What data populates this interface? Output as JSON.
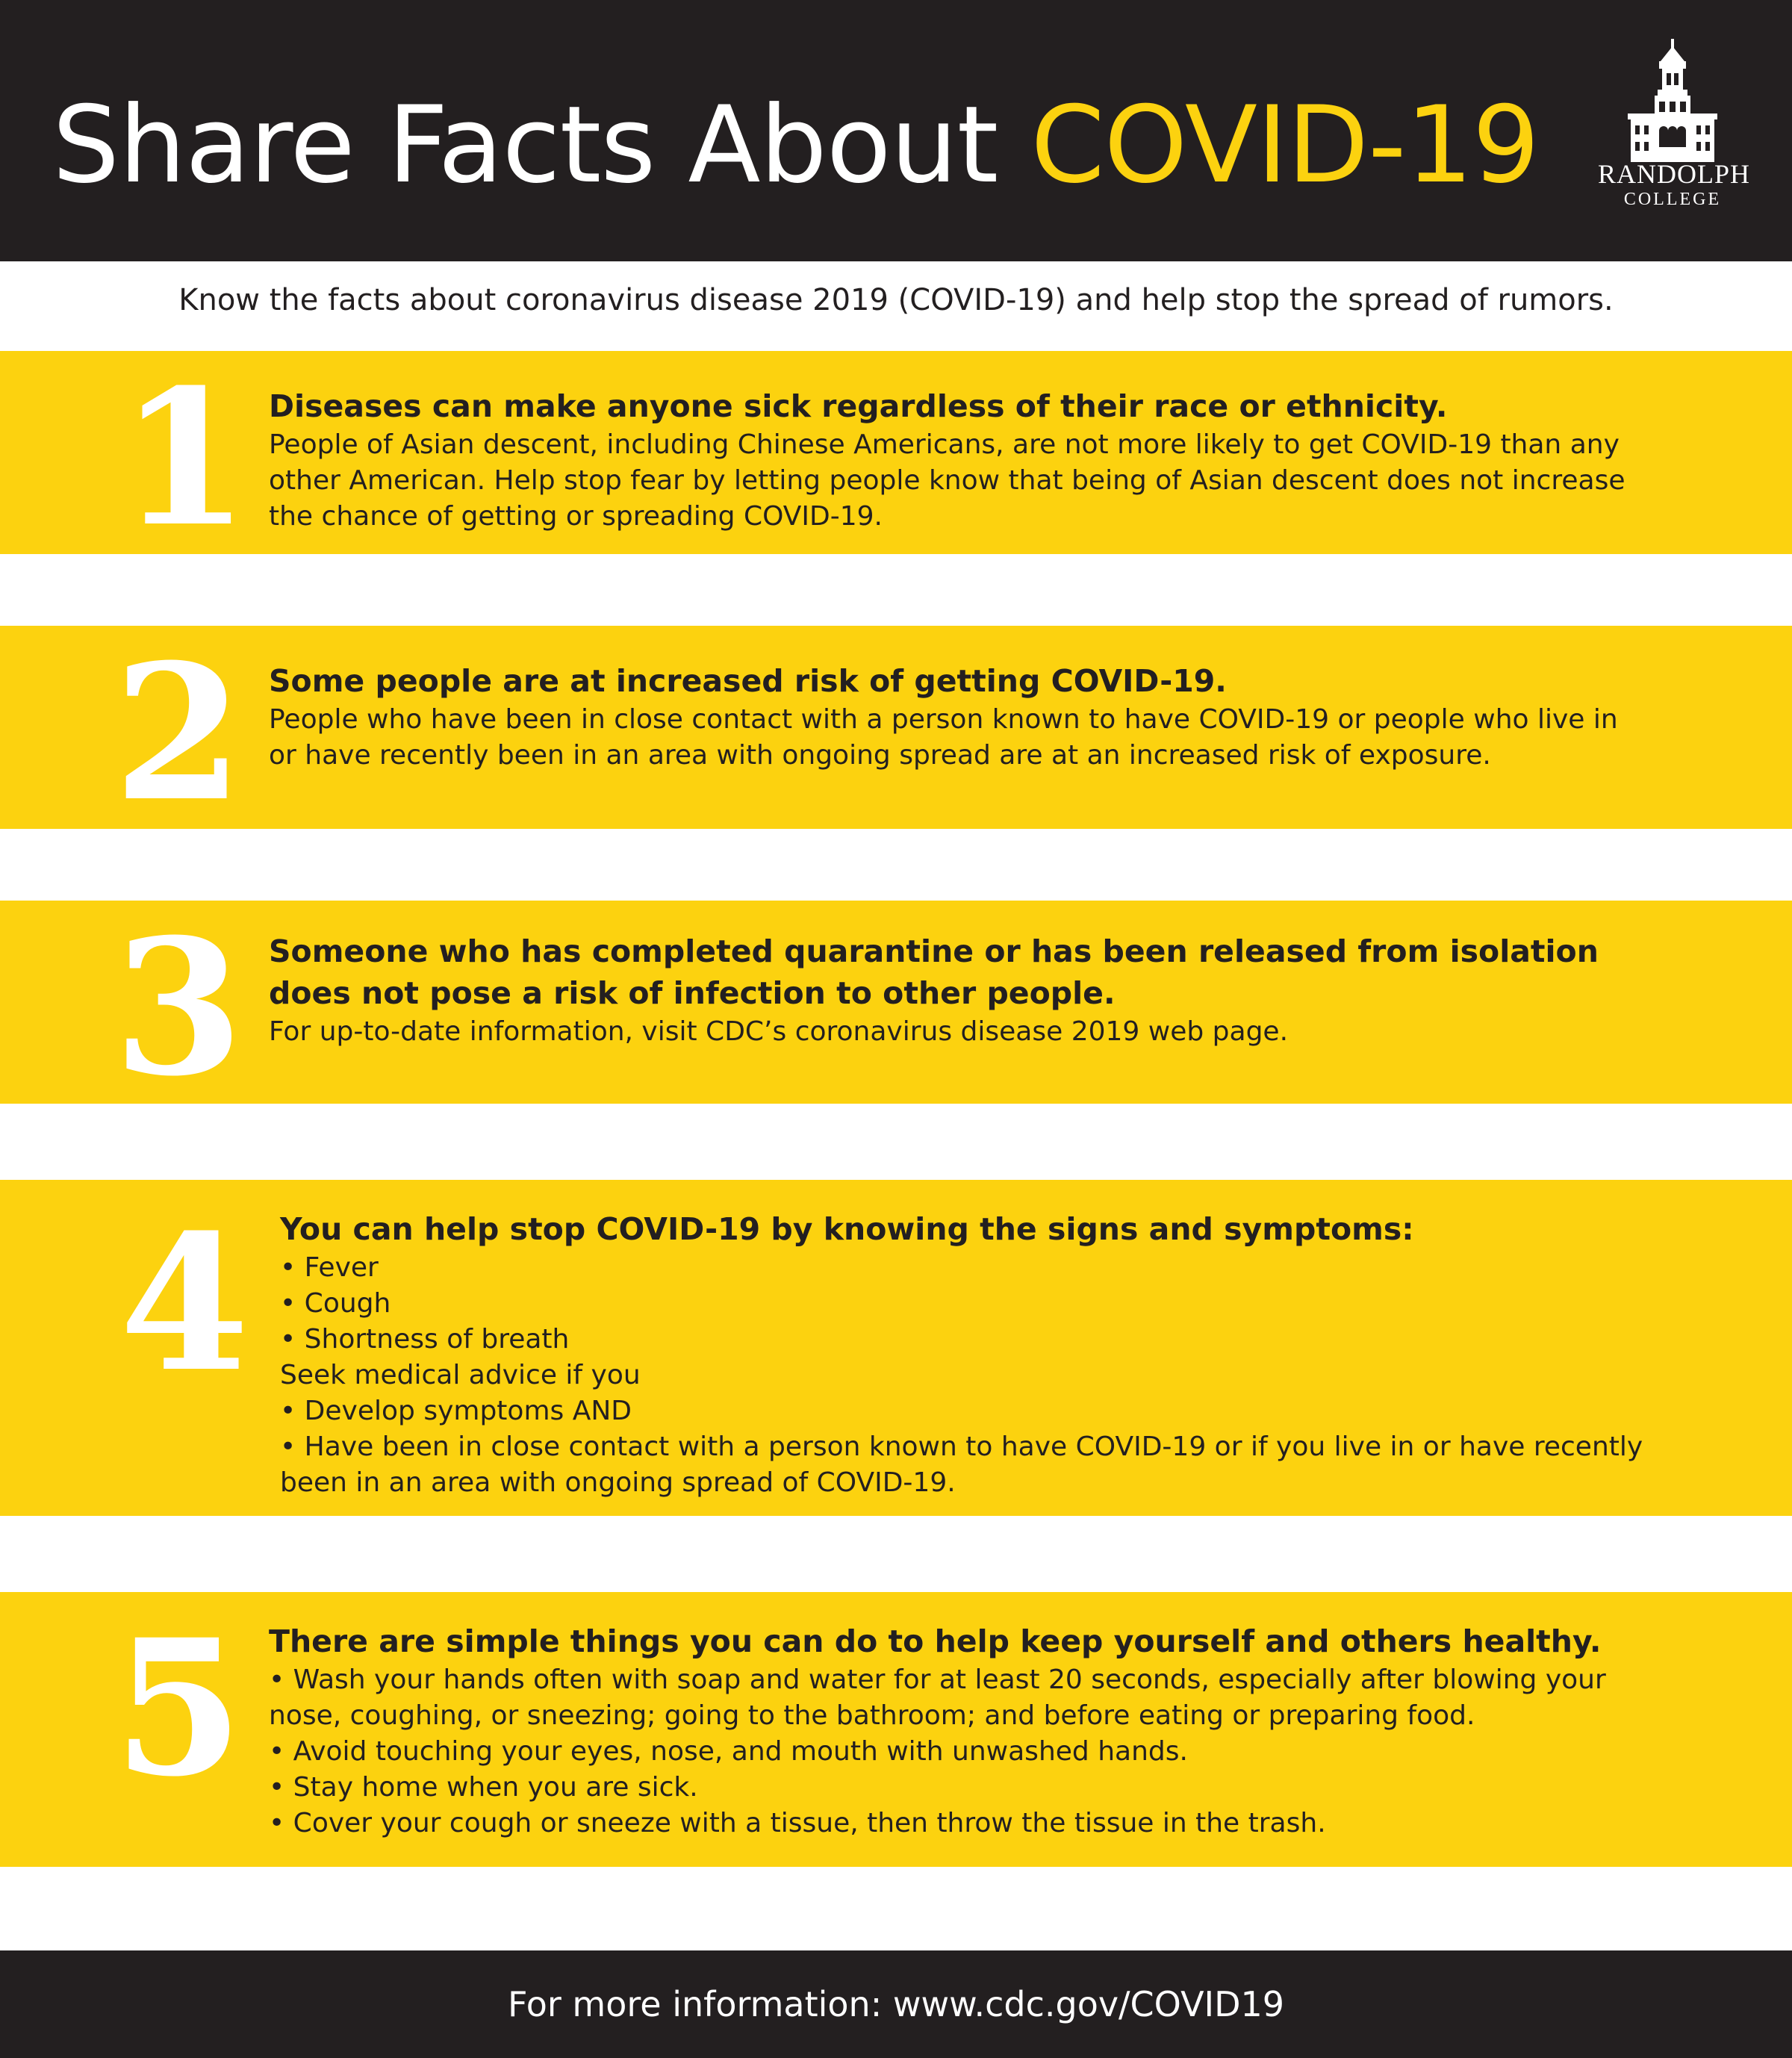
{
  "header": {
    "title_white": "Share Facts About",
    "title_yellow": "COVID-19",
    "logo": {
      "icon": "college-building-icon",
      "name": "RANDOLPH",
      "sub": "COLLEGE"
    }
  },
  "subtitle": "Know the facts about coronavirus disease 2019 (COVID-19) and help stop the spread of rumors.",
  "facts": [
    {
      "number": "1",
      "heading": "Diseases can make anyone sick regardless of their race or ethnicity.",
      "lines": [
        "People of Asian descent, including Chinese Americans, are not more likely to get COVID-19 than any",
        "other American. Help stop fear by letting people know that being of Asian descent does not increase",
        "the chance of getting or spreading COVID-19."
      ]
    },
    {
      "number": "2",
      "heading": "Some people are at increased risk of getting COVID-19.",
      "lines": [
        "People who have been in close contact with a person known to have COVID-19 or people who live in",
        "or have recently been in an area with ongoing spread are at an increased risk of exposure."
      ]
    },
    {
      "number": "3",
      "heading_lines": [
        "Someone who has completed quarantine or has been released from isolation",
        "does not pose a risk of infection to other people."
      ],
      "lines": [
        "For up-to-date information, visit CDC’s coronavirus disease 2019 web page."
      ]
    },
    {
      "number": "4",
      "heading": "You can help stop COVID-19 by knowing the signs and symptoms:",
      "lines": [
        "• Fever",
        "• Cough",
        "• Shortness of breath",
        "Seek medical advice if you",
        "• Develop symptoms AND",
        "• Have been in close contact with a person known to have COVID-19 or if you live in or have recently",
        "been in an area with ongoing spread of COVID-19."
      ]
    },
    {
      "number": "5",
      "heading": "There are simple things you can do to help keep yourself and others healthy.",
      "lines": [
        "• Wash your hands often with soap and water for at least 20 seconds, especially after blowing your",
        "nose, coughing, or sneezing; going to the bathroom; and before eating or preparing food.",
        "• Avoid touching your eyes, nose, and mouth with unwashed hands.",
        "• Stay home when you are sick.",
        "• Cover your cough or sneeze with a tissue, then throw the tissue in the trash."
      ]
    }
  ],
  "footer": "For more information: www.cdc.gov/COVID19",
  "colors": {
    "dark": "#231f20",
    "yellow": "#fcd20f",
    "white": "#ffffff"
  }
}
